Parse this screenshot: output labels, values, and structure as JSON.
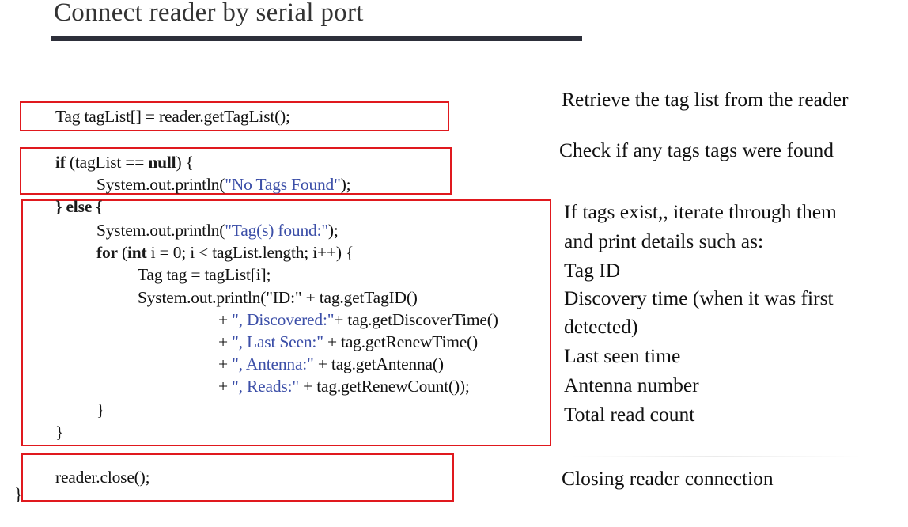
{
  "slide": {
    "title": "Connect reader by serial port"
  },
  "code": {
    "line1": "Tag tagList[] = reader.getTagList();",
    "if_kw": "if",
    "if_rest_a": " (tagList == ",
    "null_kw": "null",
    "if_rest_b": ") {",
    "println_a": "System.out.println(",
    "str_no_tags": "\"No Tags Found\"",
    "println_a_end": ");",
    "else_line": "} else {",
    "println_b": "System.out.println(",
    "str_found": "\"Tag(s) found:\"",
    "println_b_end": ");",
    "for_kw": "for",
    "for_mid": " (",
    "int_kw": "int",
    "for_rest": " i = 0; i < tagList.length; i++) {",
    "tag_assign": "Tag tag = tagList[i];",
    "println_c": "System.out.println(\"ID:\" + tag.getTagID()",
    "cont1_plus": "+ ",
    "cont1_str": "\", Discovered:\"",
    "cont1_rest": "+ tag.getDiscoverTime()",
    "cont2_plus": "+ ",
    "cont2_str": "\", Last Seen:\"",
    "cont2_rest": " + tag.getRenewTime()",
    "cont3_plus": "+ ",
    "cont3_str": "\", Antenna:\"",
    "cont3_rest": " + tag.getAntenna()",
    "cont4_plus": "+ ",
    "cont4_str": "\", Reads:\"",
    "cont4_rest": " + tag.getRenewCount());",
    "close_inner": "}",
    "close_outer": "}",
    "reader_close": "reader.close();",
    "final_brace": "}"
  },
  "notes": {
    "retrieve": "Retrieve the tag list from the reader",
    "check": "Check if any tags tags were found",
    "iterate_1": "If tags exist,, iterate through them",
    "iterate_2": "and print details such as:",
    "iterate_3": "Tag ID",
    "iterate_4": "Discovery time (when it was first",
    "iterate_5": "detected)",
    "iterate_6": "Last seen time",
    "iterate_7": "Antenna number",
    "iterate_8": "Total read count",
    "closing": "Closing reader connection"
  },
  "colors": {
    "highlight_box": "#e0191e",
    "string_literal": "#3c4fa8",
    "title_rule": "#2d2f3a"
  }
}
